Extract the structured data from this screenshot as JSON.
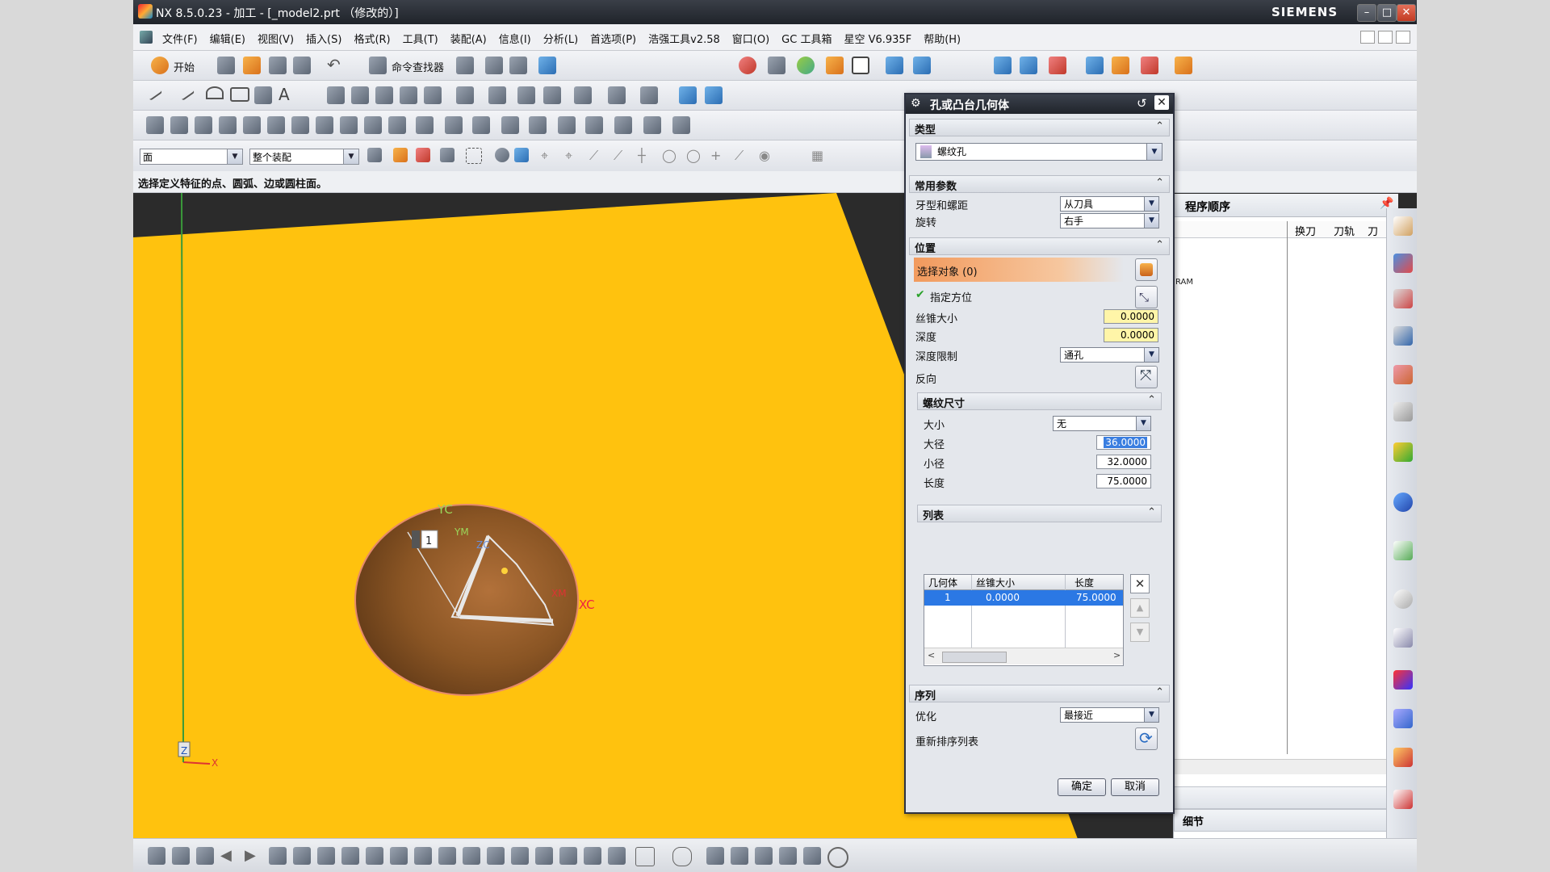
{
  "window": {
    "title": "NX 8.5.0.23 - 加工 - [_model2.prt （修改的）]",
    "brand": "SIEMENS"
  },
  "menu": [
    "文件(F)",
    "编辑(E)",
    "视图(V)",
    "插入(S)",
    "格式(R)",
    "工具(T)",
    "装配(A)",
    "信息(I)",
    "分析(L)",
    "首选项(P)",
    "浩强工具v2.58",
    "窗口(O)",
    "GC 工具箱",
    "星空 V6.935F",
    "帮助(H)"
  ],
  "toolbar": {
    "start_label": "开始",
    "command_finder_label": "命令查找器"
  },
  "filters": {
    "type_filter": "面",
    "scope_filter": "整个装配"
  },
  "status": {
    "prompt": "选择定义特征的点、圆弧、边或圆柱面。"
  },
  "viewport": {
    "axis_yc": "YC",
    "axis_xc": "XC",
    "axis_ym": "YM",
    "axis_xm": "XM",
    "axis_zc": "ZC",
    "badge": "1",
    "triad_z": "Z",
    "triad_x": "X",
    "face_color": "#ffc20e",
    "hole_color": "#8a5524"
  },
  "navigator": {
    "title": "程序顺序",
    "columns": [
      "换刀",
      "刀轨",
      "刀"
    ],
    "partial_item": "RAM",
    "footer_label": "细节"
  },
  "dialog": {
    "title": "孔或凸台几何体",
    "sections": {
      "type": "类型",
      "common": "常用参数",
      "position": "位置",
      "thread": "螺纹尺寸",
      "list": "列表",
      "sequence": "序列"
    },
    "type_value": "螺纹孔",
    "labels": {
      "thread_pitch": "牙型和螺距",
      "rotation": "旋转",
      "select_object": "选择对象 (0)",
      "specify_orientation": "指定方位",
      "tap_size": "丝锥大小",
      "depth": "深度",
      "depth_limit": "深度限制",
      "reverse": "反向",
      "size": "大小",
      "major_dia": "大径",
      "minor_dia": "小径",
      "length": "长度",
      "optimize": "优化",
      "reorder": "重新排序列表"
    },
    "values": {
      "thread_pitch": "从刀具",
      "rotation": "右手",
      "tap_size": "0.0000",
      "depth": "0.0000",
      "depth_limit": "通孔",
      "size": "无",
      "major_dia": "36.0000",
      "minor_dia": "32.0000",
      "length": "75.0000",
      "optimize": "最接近"
    },
    "list_table": {
      "headers": [
        "几何体",
        "丝锥大小",
        "长度"
      ],
      "rows": [
        [
          "1",
          "0.0000",
          "75.0000"
        ]
      ]
    },
    "ok_label": "确定",
    "cancel_label": "取消"
  }
}
